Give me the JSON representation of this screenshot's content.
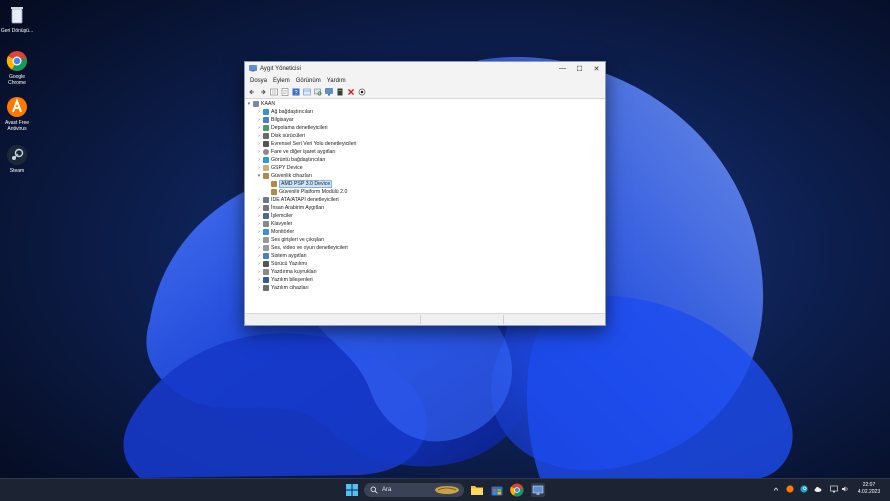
{
  "desktop": {
    "icons": [
      {
        "label": "Geri Dönüşü..."
      },
      {
        "label": "Google Chrome"
      },
      {
        "label": "Avast Free Antivirus"
      },
      {
        "label": "Steam"
      }
    ]
  },
  "window": {
    "title": "Aygıt Yöneticisi",
    "controls": {
      "minimize": "—",
      "maximize": "☐",
      "close": "✕"
    },
    "menu": [
      "Dosya",
      "Eylem",
      "Görünüm",
      "Yardım"
    ],
    "tree": {
      "root": "KAAN",
      "categories": [
        "Ağ bağdaştırıcıları",
        "Bilgisayar",
        "Depolama denetleyicileri",
        "Disk sürücüleri",
        "Evrensel Seri Veri Yolu denetleyicileri",
        "Fare ve diğer işaret aygıtları",
        "Görüntü bağdaştırıcıları",
        "GSPY Device",
        "Güvenlik cihazları",
        "AMD PSP 3.0 Device",
        "Güvenilir Platform Modülü 2.0",
        "IDE ATA/ATAPI denetleyicileri",
        "İnsan Arabirim Aygıtları",
        "İşlemciler",
        "Klavyeler",
        "Monitörler",
        "Ses girişleri ve çıkışları",
        "Ses, video ve oyun denetleyicileri",
        "Sistem aygıtları",
        "Sürücü Yazılımı",
        "Yazdırma kuyrukları",
        "Yazılım bileşenleri",
        "Yazılım cihazları"
      ]
    }
  },
  "taskbar": {
    "search_label": "Ara",
    "time": "22:07",
    "date": "4.02.2023"
  },
  "colors": {
    "accent": "#0067c0",
    "taskbar": "#1c2333",
    "selection": "#cfe3f7"
  }
}
